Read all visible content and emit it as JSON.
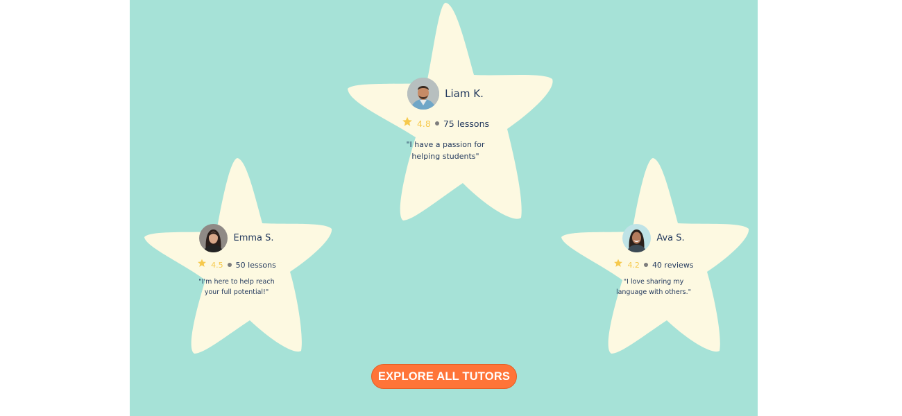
{
  "colors": {
    "background": "#a6e2d7",
    "star_fill": "#fdf9e1",
    "rating": "#f6c94c",
    "text": "#243a5e",
    "button": "#ff7438"
  },
  "tutors": [
    {
      "name": "Liam K.",
      "rating": "4.8",
      "count_label": "75 lessons",
      "quote": "\"I have a passion for helping students\"",
      "icon": "star-icon",
      "avatar": "man-portrait-avatar"
    },
    {
      "name": "Emma S.",
      "rating": "4.5",
      "count_label": "50 lessons",
      "quote": "\"I'm here to help reach your full potential!\"",
      "icon": "star-icon",
      "avatar": "woman-portrait-avatar"
    },
    {
      "name": "Ava S.",
      "rating": "4.2",
      "count_label": "40 reviews",
      "quote": "\"I love sharing my language with others.\"",
      "icon": "star-icon",
      "avatar": "woman-portrait-avatar"
    }
  ],
  "cta": {
    "label": "EXPLORE ALL TUTORS"
  }
}
